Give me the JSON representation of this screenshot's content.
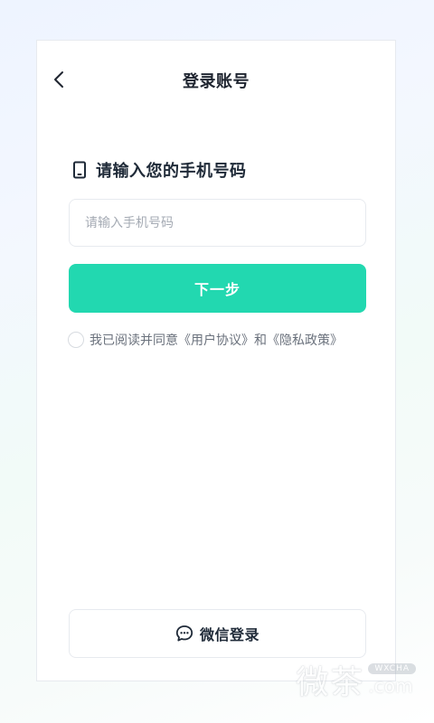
{
  "header": {
    "title": "登录账号",
    "back_icon": "chevron-left-icon"
  },
  "prompt": {
    "icon": "phone-icon",
    "text": "请输入您的手机号码"
  },
  "phone_input": {
    "value": "",
    "placeholder": "请输入手机号码"
  },
  "next_button": {
    "label": "下一步",
    "color": "#22d8b0"
  },
  "agreement": {
    "checked": false,
    "prefix": "我已阅读并同意",
    "user_agreement": "《用户协议》",
    "conjunction": "和",
    "privacy_policy": "《隐私政策》"
  },
  "wechat_login": {
    "icon": "chat-bubble-icon",
    "label": "微信登录"
  },
  "watermark": {
    "main": "微茶",
    "badge": "WXCHA",
    "domain": ".com"
  }
}
